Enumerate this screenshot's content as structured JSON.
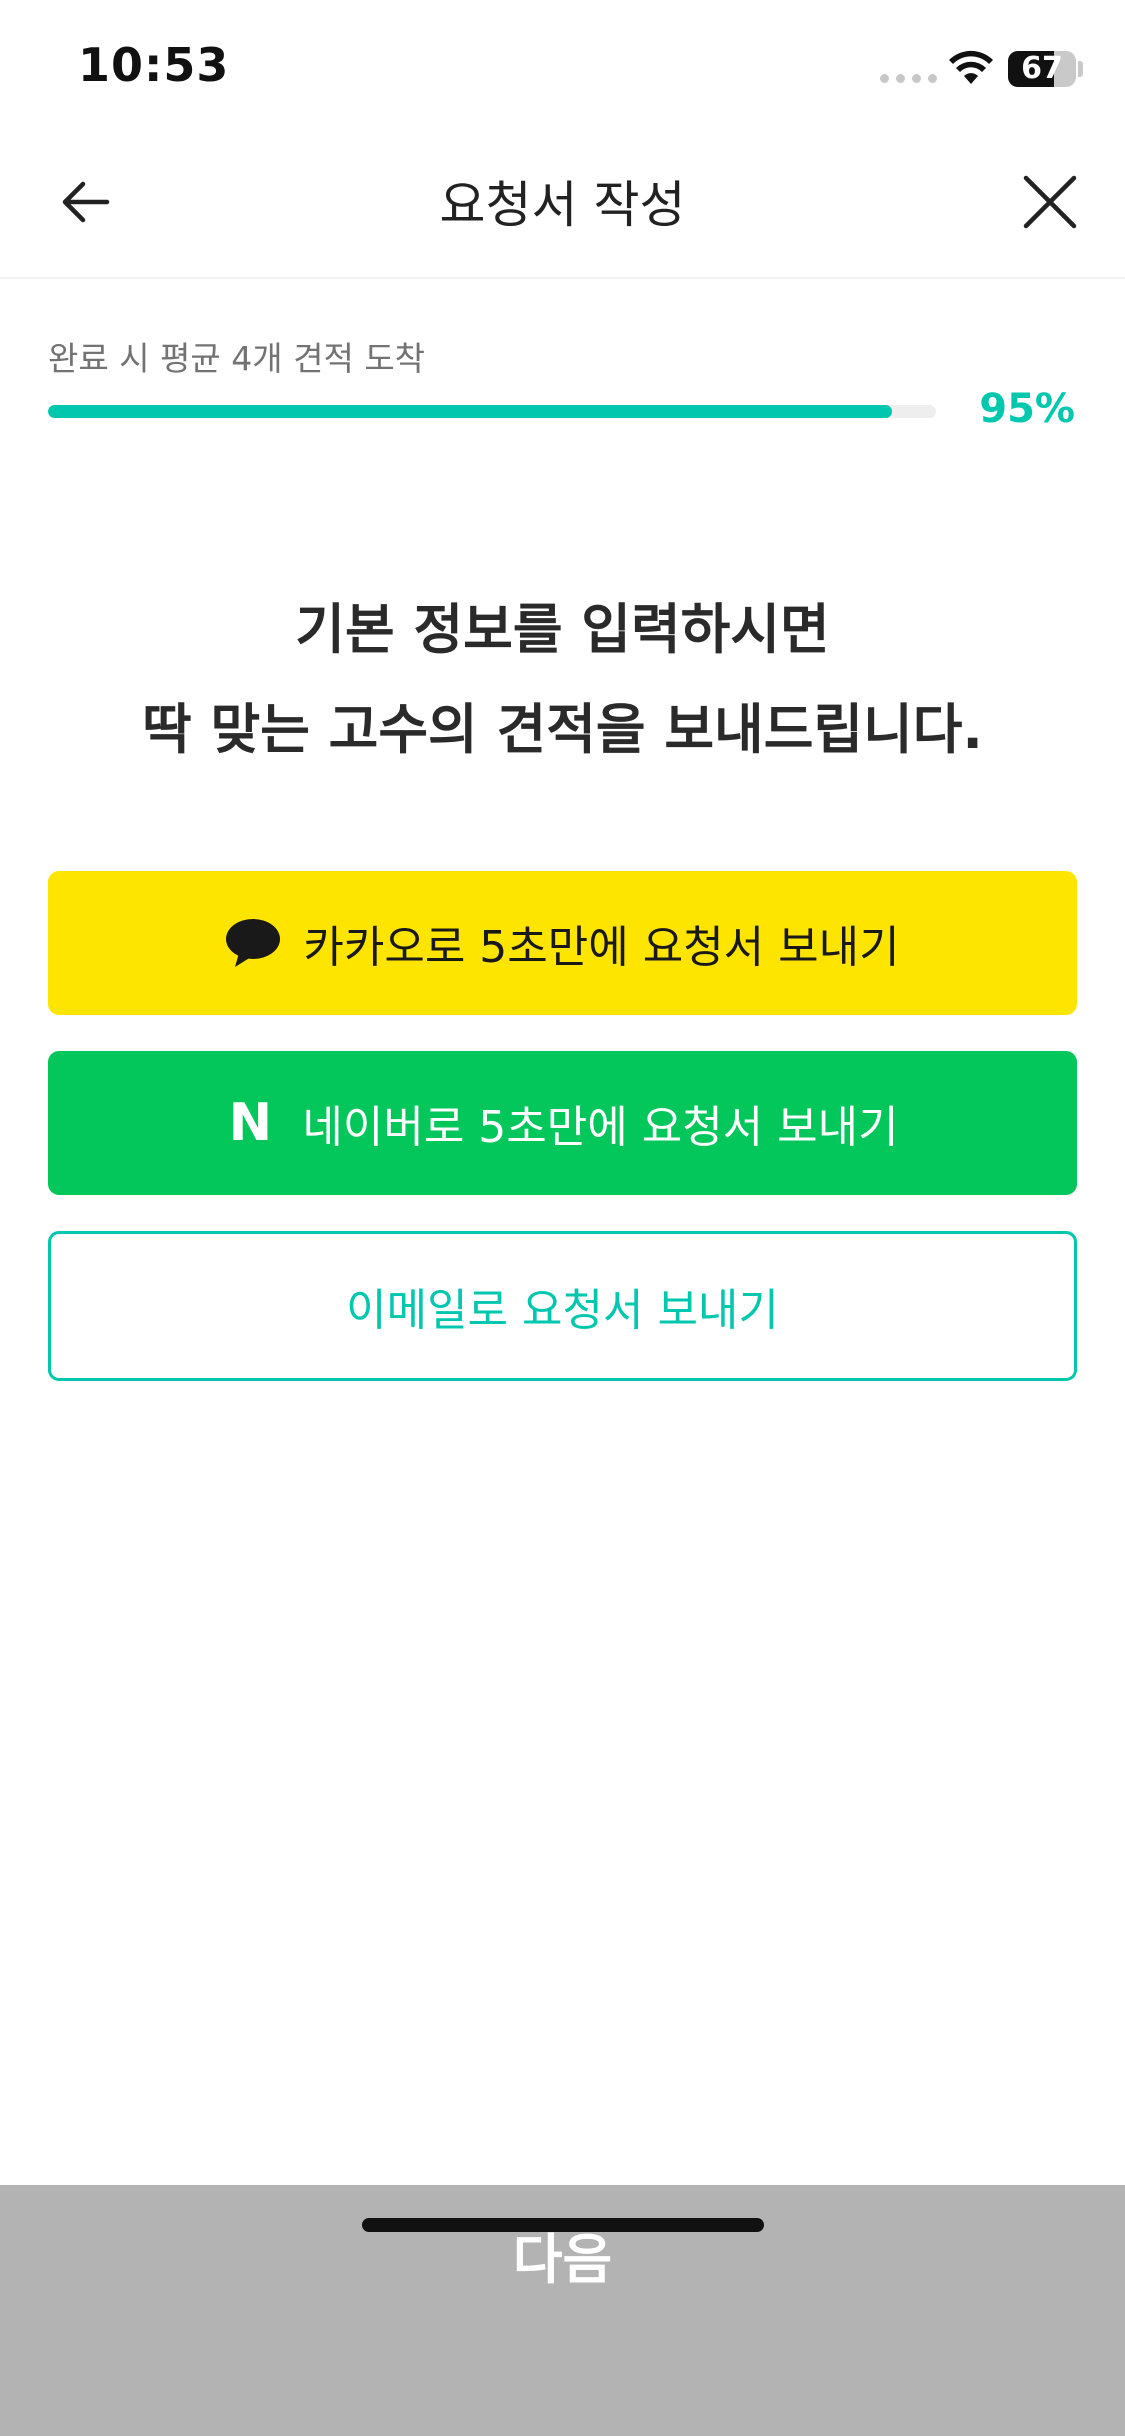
{
  "status_bar": {
    "time": "10:53",
    "battery_text": "67",
    "battery_level": 0.67
  },
  "header": {
    "title": "요청서 작성",
    "back_icon": "arrow-left-icon",
    "close_icon": "close-icon"
  },
  "progress": {
    "caption": "완료 시 평균 4개 견적 도착",
    "percent_label": "95%",
    "value": 0.95,
    "color": "#00c7ae"
  },
  "headline": {
    "line1": "기본 정보를 입력하시면",
    "line2": "딱 맞는 고수의 견적을 보내드립니다."
  },
  "buttons": {
    "kakao": {
      "label": "카카오로 5초만에 요청서 보내기",
      "icon": "speech-bubble-icon",
      "color": "#fee500"
    },
    "naver": {
      "label": "네이버로 5초만에 요청서 보내기",
      "icon_text": "N",
      "color": "#03c75a"
    },
    "email": {
      "label": "이메일로 요청서 보내기",
      "color": "#00c7ae"
    }
  },
  "footer": {
    "next_label": "다음",
    "color": "#b3b3b3"
  }
}
